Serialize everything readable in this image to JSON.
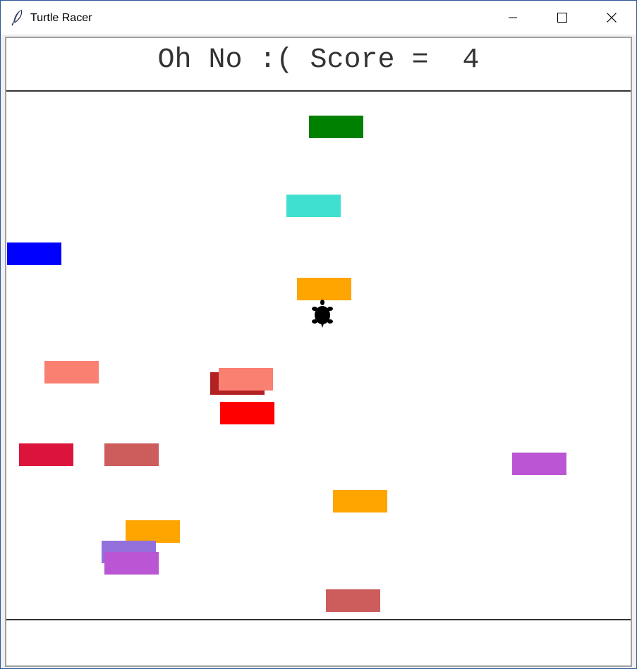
{
  "window": {
    "title": "Turtle Racer",
    "app_icon": "feather-icon",
    "controls": {
      "minimize": "minimize-icon",
      "maximize": "maximize-icon",
      "close": "close-icon"
    }
  },
  "game": {
    "status_text": "Oh No :( Score =  4",
    "score": 4,
    "player": {
      "icon": "turtle-icon",
      "color": "#000000"
    },
    "obstacles": [
      {
        "name": "green-block",
        "color": "#008000"
      },
      {
        "name": "turquoise-block",
        "color": "#40e0d0"
      },
      {
        "name": "blue-block",
        "color": "#0000ff"
      },
      {
        "name": "orange-block",
        "color": "#ffa500"
      },
      {
        "name": "salmon-block",
        "color": "#fa8072"
      },
      {
        "name": "firebrick-block",
        "color": "#b22222"
      },
      {
        "name": "salmon-block",
        "color": "#fa8072"
      },
      {
        "name": "red-block",
        "color": "#ff0000"
      },
      {
        "name": "crimson-block",
        "color": "#dc143c"
      },
      {
        "name": "indianred-block",
        "color": "#cd5c5c"
      },
      {
        "name": "orchid-block",
        "color": "#ba55d3"
      },
      {
        "name": "orange-block",
        "color": "#ffa500"
      },
      {
        "name": "orange-block",
        "color": "#ffa500"
      },
      {
        "name": "mediumpurple-block",
        "color": "#9370db"
      },
      {
        "name": "orchid-block",
        "color": "#ba55d3"
      },
      {
        "name": "indianred-block",
        "color": "#cd5c5c"
      }
    ]
  }
}
